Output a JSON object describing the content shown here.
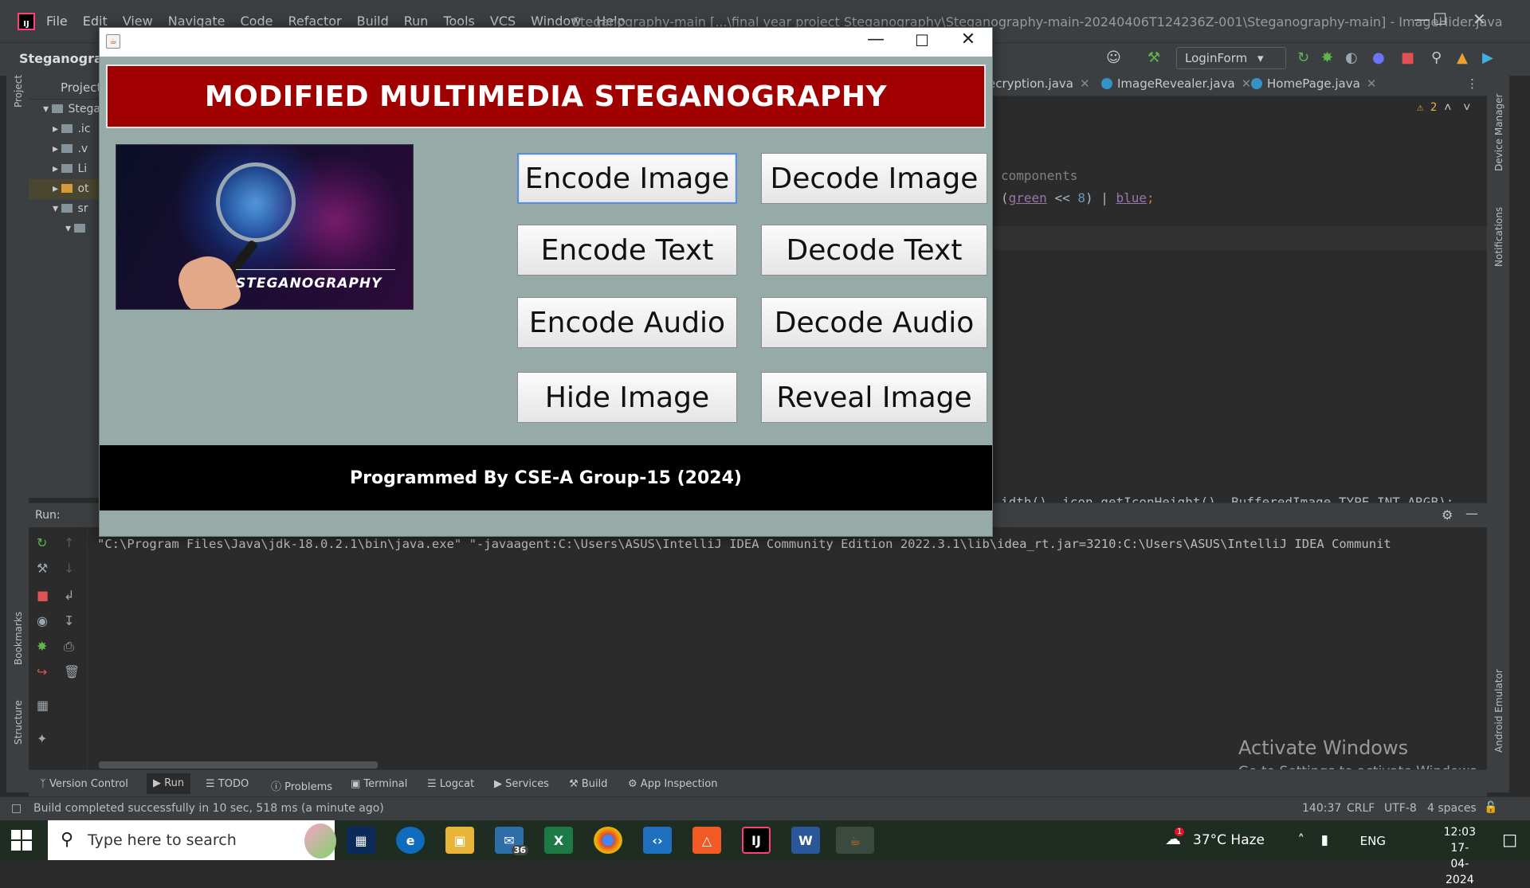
{
  "ide": {
    "menu": [
      "File",
      "Edit",
      "View",
      "Navigate",
      "Code",
      "Refactor",
      "Build",
      "Run",
      "Tools",
      "VCS",
      "Window",
      "Help"
    ],
    "title": "Steganography-main [...\\final year project Steganography\\Steganography-main-20240406T124236Z-001\\Steganography-main] - ImageHider.java",
    "project_name": "Steganograph",
    "run_config": "LoginForm",
    "project_panel_label": "Project",
    "tree_labels": [
      "Stega",
      ".ic",
      ".v",
      "Li",
      "ot",
      "sr"
    ],
    "editor_tabs": [
      "ecryption.java",
      "ImageRevealer.java",
      "HomePage.java"
    ],
    "warning_count": "2",
    "code": {
      "comment": "components",
      "line2_var1": "green",
      "line2_op": " << ",
      "line2_num": "8",
      "line2_op2": ") | ",
      "line2_var2": "blue",
      "line2_end": ";",
      "line2_start": "(",
      "partial_line": "idth(), icon.getIconHeight(), BufferedImage.TYPE_INT_ARGB);"
    },
    "run_label": "Run:",
    "console_text": "\"C:\\Program Files\\Java\\jdk-18.0.2.1\\bin\\java.exe\" \"-javaagent:C:\\Users\\ASUS\\IntelliJ IDEA Community Edition 2022.3.1\\lib\\idea_rt.jar=3210:C:\\Users\\ASUS\\IntelliJ IDEA Communit",
    "left_stripe": [
      "Project",
      "Bookmarks",
      "Structure"
    ],
    "right_stripe": [
      "Device Manager",
      "Notifications",
      "Android Emulator"
    ],
    "bottom_tabs": [
      "Version Control",
      "Run",
      "TODO",
      "Problems",
      "Terminal",
      "Logcat",
      "Services",
      "Build",
      "App Inspection"
    ],
    "status_message": "Build completed successfully in 10 sec, 518 ms (a minute ago)",
    "status_right": [
      "140:37",
      "CRLF",
      "UTF-8",
      "4 spaces"
    ]
  },
  "activate": {
    "line1": "Activate Windows",
    "line2": "Go to Settings to activate Windows."
  },
  "app": {
    "banner": "MODIFIED MULTIMEDIA STEGANOGRAPHY",
    "image_caption": "STEGANOGRAPHY",
    "buttons": {
      "encode_image": "Encode Image",
      "decode_image": "Decode Image",
      "encode_text": "Encode Text",
      "decode_text": "Decode Text",
      "encode_audio": "Encode Audio",
      "decode_audio": "Decode Audio",
      "hide_image": "Hide Image",
      "reveal_image": "Reveal Image"
    },
    "footer": "Programmed By CSE-A Group-15 (2024)",
    "colors": {
      "banner": "#a10000",
      "background": "#96aba8",
      "footer": "#000000"
    }
  },
  "taskbar": {
    "search_placeholder": "Type here to search",
    "mail_badge": "36",
    "weather_badge": "1",
    "weather": "37°C  Haze",
    "language": "ENG",
    "time": "12:03",
    "date": "17-04-2024"
  }
}
